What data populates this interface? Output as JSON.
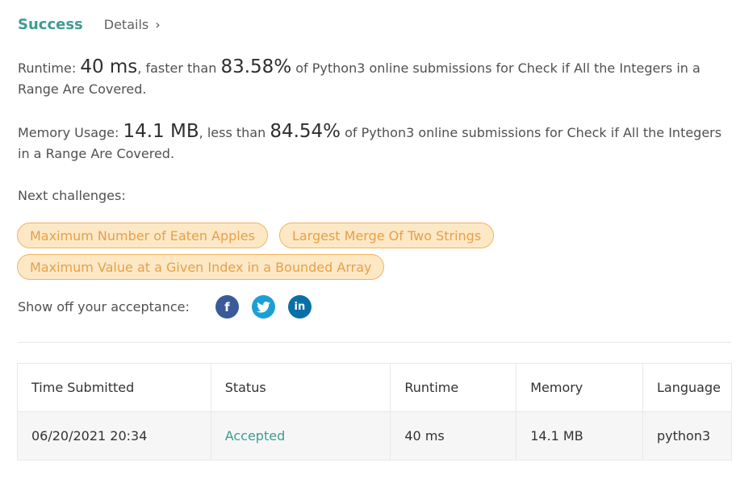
{
  "header": {
    "status": "Success",
    "details_label": "Details",
    "details_chevron": "›"
  },
  "runtime": {
    "label": "Runtime:",
    "value": "40 ms",
    "mid": ", faster than",
    "percent": "83.58%",
    "suffix": "of Python3 online submissions for Check if All the Integers in a Range Are Covered."
  },
  "memory": {
    "label": "Memory Usage:",
    "value": "14.1 MB",
    "mid": ", less than",
    "percent": "84.54%",
    "suffix": "of Python3 online submissions for Check if All the Integers in a Range Are Covered."
  },
  "next": {
    "label": "Next challenges:",
    "items": [
      "Maximum Number of Eaten Apples",
      "Largest Merge Of Two Strings",
      "Maximum Value at a Given Index in a Bounded Array"
    ]
  },
  "share": {
    "label": "Show off your acceptance:",
    "icons": {
      "facebook": "f",
      "twitter": "t",
      "linkedin": "in"
    }
  },
  "table": {
    "headers": [
      "Time Submitted",
      "Status",
      "Runtime",
      "Memory",
      "Language"
    ],
    "rows": [
      {
        "time": "06/20/2021 20:34",
        "status": "Accepted",
        "runtime": "40 ms",
        "memory": "14.1 MB",
        "language": "python3"
      }
    ]
  },
  "colors": {
    "accent": "#3d9c93",
    "chip_bg": "#fde8c6",
    "chip_border": "#f5b25a",
    "chip_text": "#e5a04a"
  }
}
